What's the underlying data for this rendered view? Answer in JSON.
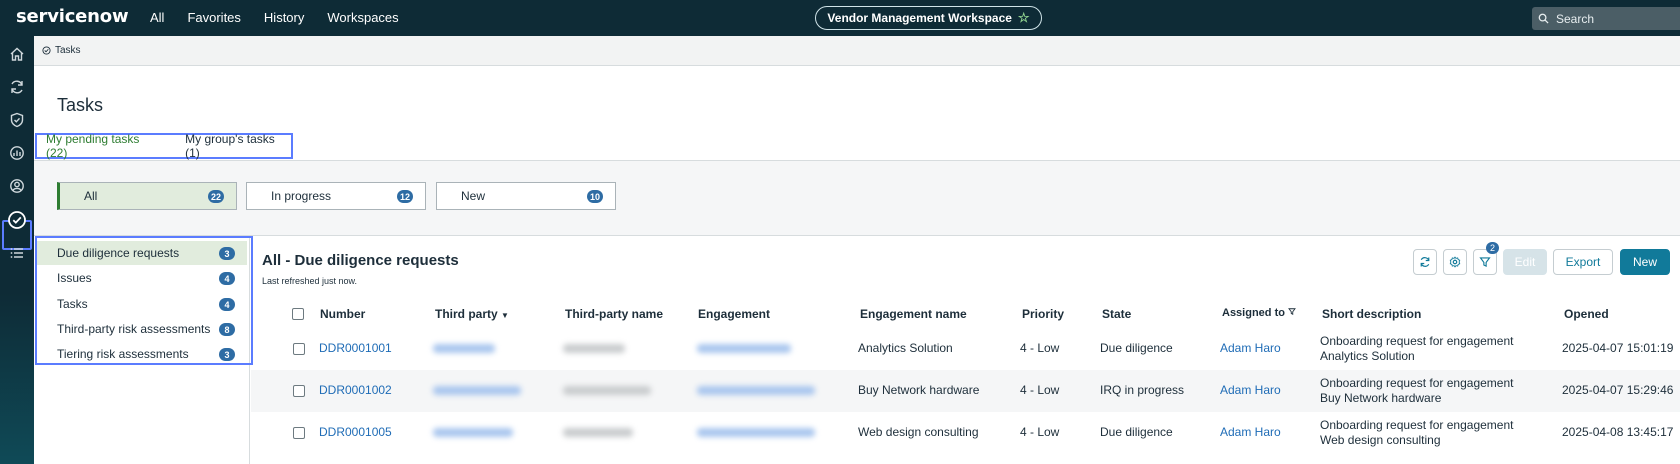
{
  "topbar": {
    "logo_text": "servicenow",
    "nav": [
      "All",
      "Favorites",
      "History",
      "Workspaces"
    ],
    "workspace_title": "Vendor Management Workspace",
    "search_placeholder": "Search"
  },
  "breadcrumb": {
    "label": "Tasks"
  },
  "page": {
    "title": "Tasks"
  },
  "tabs": [
    {
      "label": "My pending tasks (22)",
      "active": true
    },
    {
      "label": "My group's tasks (1)",
      "active": false
    }
  ],
  "filters": [
    {
      "label": "All",
      "count": "22",
      "active": true
    },
    {
      "label": "In progress",
      "count": "12",
      "active": false
    },
    {
      "label": "New",
      "count": "10",
      "active": false
    }
  ],
  "lists": [
    {
      "label": "Due diligence requests",
      "count": "3",
      "selected": true
    },
    {
      "label": "Issues",
      "count": "4",
      "selected": false
    },
    {
      "label": "Tasks",
      "count": "4",
      "selected": false
    },
    {
      "label": "Third-party risk assessments",
      "count": "8",
      "selected": false
    },
    {
      "label": "Tiering risk assessments",
      "count": "3",
      "selected": false
    }
  ],
  "list": {
    "title": "All - Due diligence requests",
    "refreshed": "Last refreshed just now.",
    "filter_badge": "2",
    "buttons": {
      "edit": "Edit",
      "export": "Export",
      "new": "New"
    }
  },
  "columns": [
    "Number",
    "Third party",
    "Third-party name",
    "Engagement",
    "Engagement name",
    "Priority",
    "State",
    "Assigned to",
    "Short description",
    "Opened"
  ],
  "rows": [
    {
      "number": "DDR0001001",
      "engagement_name": "Analytics Solution",
      "priority": "4 - Low",
      "state": "Due diligence",
      "assigned_to": "Adam Haro",
      "desc1": "Onboarding request for engagement",
      "desc2": "Analytics Solution",
      "opened": "2025-04-07 15:01:19"
    },
    {
      "number": "DDR0001002",
      "engagement_name": "Buy Network hardware",
      "priority": "4 - Low",
      "state": "IRQ in progress",
      "assigned_to": "Adam Haro",
      "desc1": "Onboarding request for engagement",
      "desc2": "Buy Network hardware",
      "opened": "2025-04-07 15:29:46"
    },
    {
      "number": "DDR0001005",
      "engagement_name": "Web design consulting",
      "priority": "4 - Low",
      "state": "Due diligence",
      "assigned_to": "Adam Haro",
      "desc1": "Onboarding request for engagement",
      "desc2": "Web design consulting",
      "opened": "2025-04-08 13:45:17"
    }
  ],
  "colors": {
    "header_bg": "#0e2b36",
    "accent_green": "#2e7d32",
    "link_blue": "#1f6cb6",
    "primary_button": "#117a9a",
    "highlight_box": "#5b7cff"
  }
}
